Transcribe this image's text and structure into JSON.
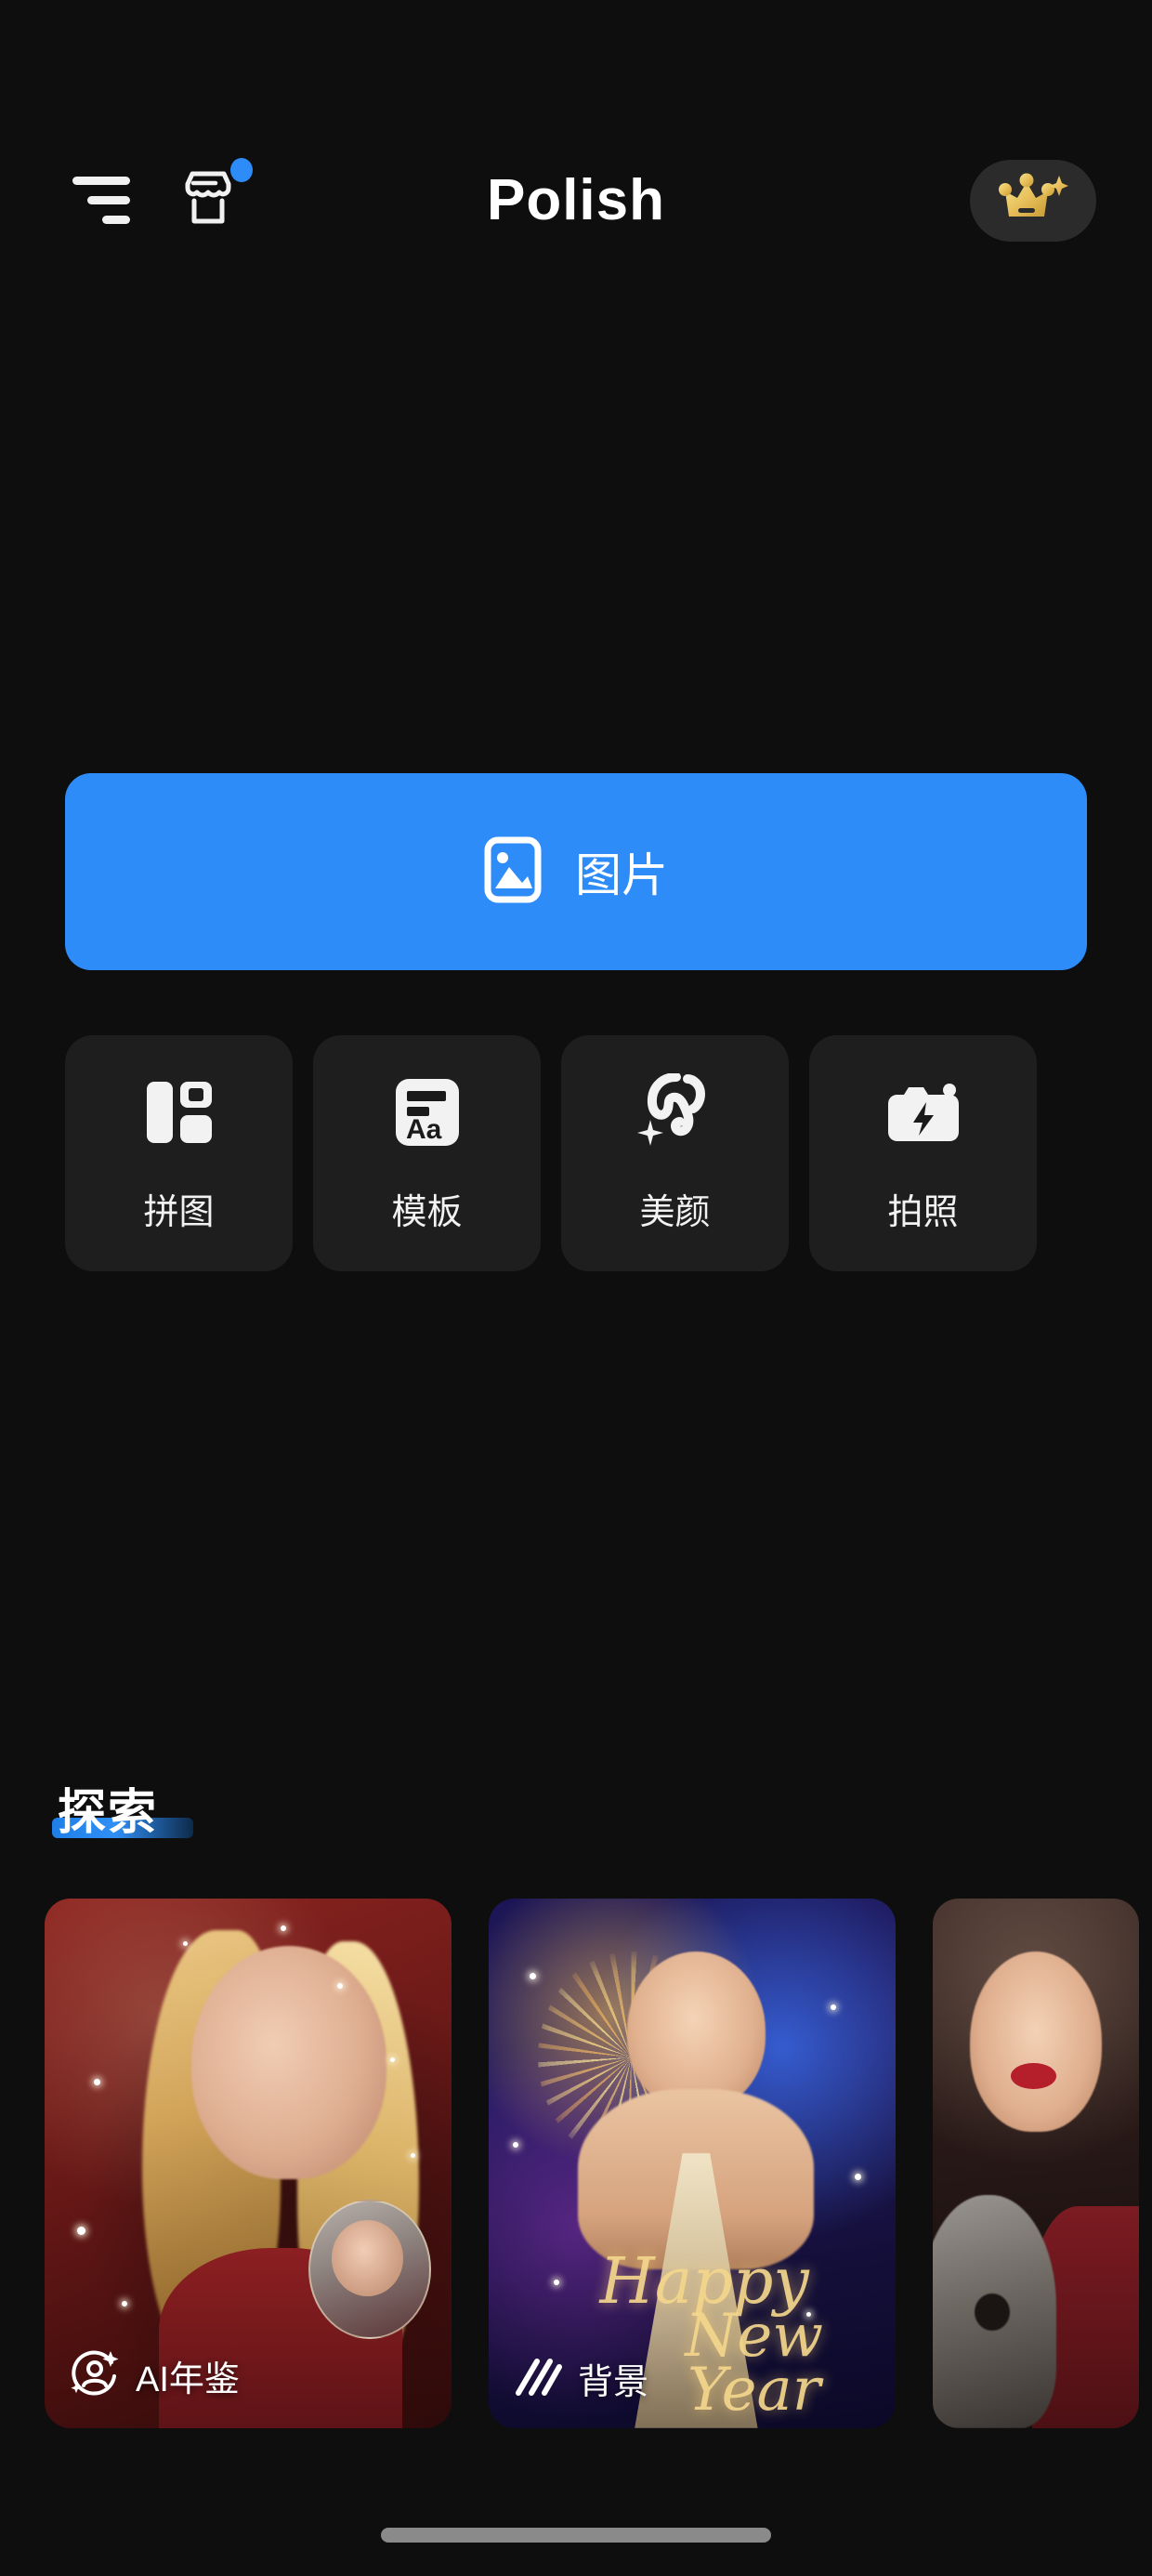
{
  "app": {
    "title": "Polish",
    "background_color": "#0e0e0e",
    "accent_color": "#2d8cf8"
  },
  "header": {
    "menu_icon": "hamburger-menu-icon",
    "store_icon": "storefront-icon",
    "store_badge": true,
    "logo_text": "Polish",
    "vip_icon": "crown-sparkle-icon",
    "vip_color": "#e8c05a"
  },
  "primary_action": {
    "label": "图片",
    "icon": "image-picture-icon",
    "color": "#2d8cf8"
  },
  "tools": [
    {
      "label": "拼图",
      "icon": "collage-grid-icon"
    },
    {
      "label": "模板",
      "icon": "template-text-icon"
    },
    {
      "label": "美颜",
      "icon": "beauty-face-icon"
    },
    {
      "label": "拍照",
      "icon": "camera-flash-icon"
    }
  ],
  "explore": {
    "title": "探索",
    "cards": [
      {
        "label": "AI年鉴",
        "icon": "ai-portrait-sparkle-icon"
      },
      {
        "label": "背景",
        "icon": "diagonal-stripes-icon"
      },
      {
        "label": "",
        "icon": ""
      }
    ]
  },
  "card2_art_text": {
    "line1": "Happy",
    "line2": "New Year"
  },
  "system": {
    "home_indicator": "home-indicator-bar"
  }
}
